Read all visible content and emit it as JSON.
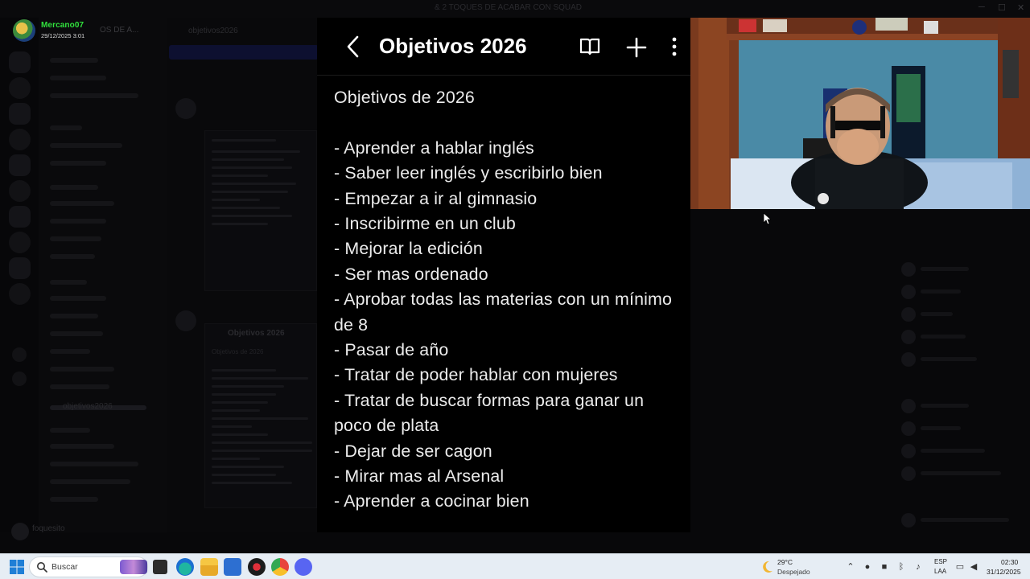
{
  "window": {
    "title": "& 2 TOQUES DE ACABAR CON SQUAD",
    "server_name": "OS DE A..."
  },
  "profile": {
    "username": "Mercano07",
    "timestamp": "29/12/2025 3:01",
    "name_color": "#31e23d"
  },
  "discord_bg": {
    "channel_header": "objetivos2026",
    "user_strip_name": "foquesito",
    "card_title": "Objetivos 2026",
    "card_subtitle": "Objetivos de 2026"
  },
  "note_app": {
    "title": "Objetivos 2026",
    "heading": "Objetivos de 2026",
    "items": [
      "- Aprender a hablar inglés",
      "- Saber leer inglés y escribirlo bien",
      "- Empezar a ir al gimnasio",
      "- Inscribirme en un club",
      "- Mejorar la edición",
      "- Ser mas ordenado",
      "- Aprobar todas las materias con un mínimo de 8",
      "- Pasar de año",
      "- Tratar de poder hablar con mujeres",
      "- Tratar de buscar formas para ganar un poco de plata",
      "- Dejar de ser cagon",
      "- Mirar mas al Arsenal",
      "- Aprender a cocinar bien"
    ],
    "icons": [
      "back-icon",
      "book-icon",
      "plus-icon",
      "more-icon"
    ]
  },
  "taskbar": {
    "search_placeholder": "Buscar",
    "weather_temp": "29°C",
    "weather_desc": "Despejado",
    "lang_primary": "ESP",
    "lang_secondary": "LAA",
    "time": "02:30",
    "date": "31/12/2025"
  }
}
